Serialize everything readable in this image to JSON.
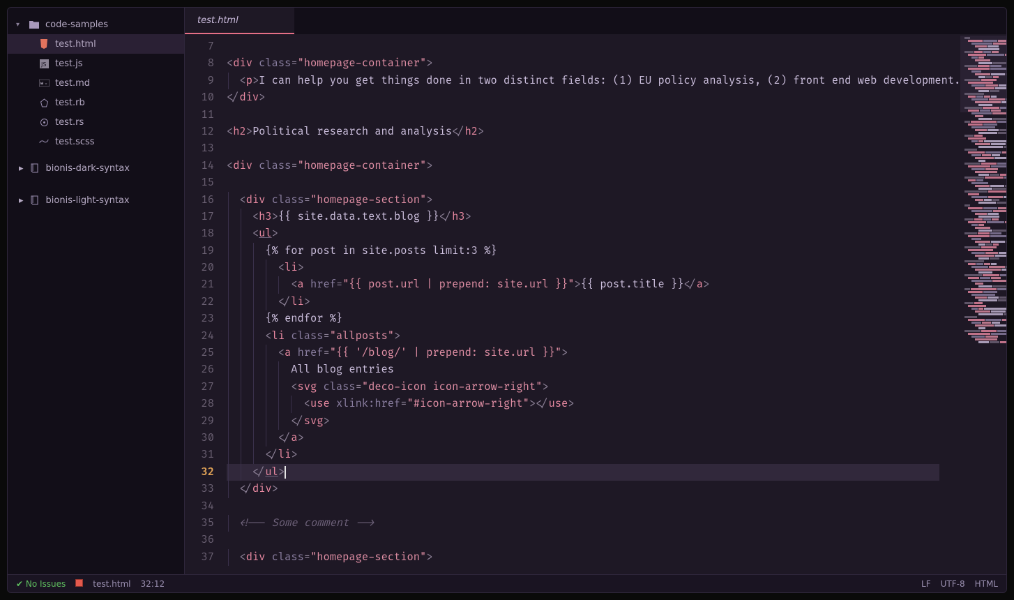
{
  "tree": {
    "root": "code-samples",
    "files": [
      {
        "name": "test.html",
        "icon": "html"
      },
      {
        "name": "test.js",
        "icon": "js"
      },
      {
        "name": "test.md",
        "icon": "md"
      },
      {
        "name": "test.rb",
        "icon": "rb"
      },
      {
        "name": "test.rs",
        "icon": "rs"
      },
      {
        "name": "test.scss",
        "icon": "scss"
      }
    ],
    "folders": [
      "bionis-dark-syntax",
      "bionis-light-syntax"
    ]
  },
  "tab": {
    "label": "test.html"
  },
  "editor": {
    "first_line": 7,
    "active_line": 32,
    "lines": [
      "",
      "<div class=\"homepage-container\">",
      "  <p>I can help you get things done in two distinct fields: (1) EU policy analysis, (2) front end web development.",
      "</div>",
      "",
      "<h2>Political research and analysis</h2>",
      "",
      "<div class=\"homepage-container\">",
      "",
      "  <div class=\"homepage-section\">",
      "    <h3>{{ site.data.text.blog }}</h3>",
      "    <ul>",
      "      {% for post in site.posts limit:3 %}",
      "        <li>",
      "          <a href=\"{{ post.url | prepend: site.url }}\">{{ post.title }}</a>",
      "        </li>",
      "      {% endfor %}",
      "      <li class=\"allposts\">",
      "        <a href=\"{{ '/blog/' | prepend: site.url }}\">",
      "          All blog entries",
      "          <svg class=\"deco-icon icon-arrow-right\">",
      "            <use xlink:href=\"#icon-arrow-right\"></use>",
      "          </svg>",
      "        </a>",
      "      </li>",
      "    </ul>",
      "  </div>",
      "",
      "  <!-- Some comment -->",
      "",
      "  <div class=\"homepage-section\">"
    ]
  },
  "status": {
    "issues": "No Issues",
    "file": "test.html",
    "cursor": "32:12",
    "eol": "LF",
    "encoding": "UTF-8",
    "lang": "HTML"
  }
}
